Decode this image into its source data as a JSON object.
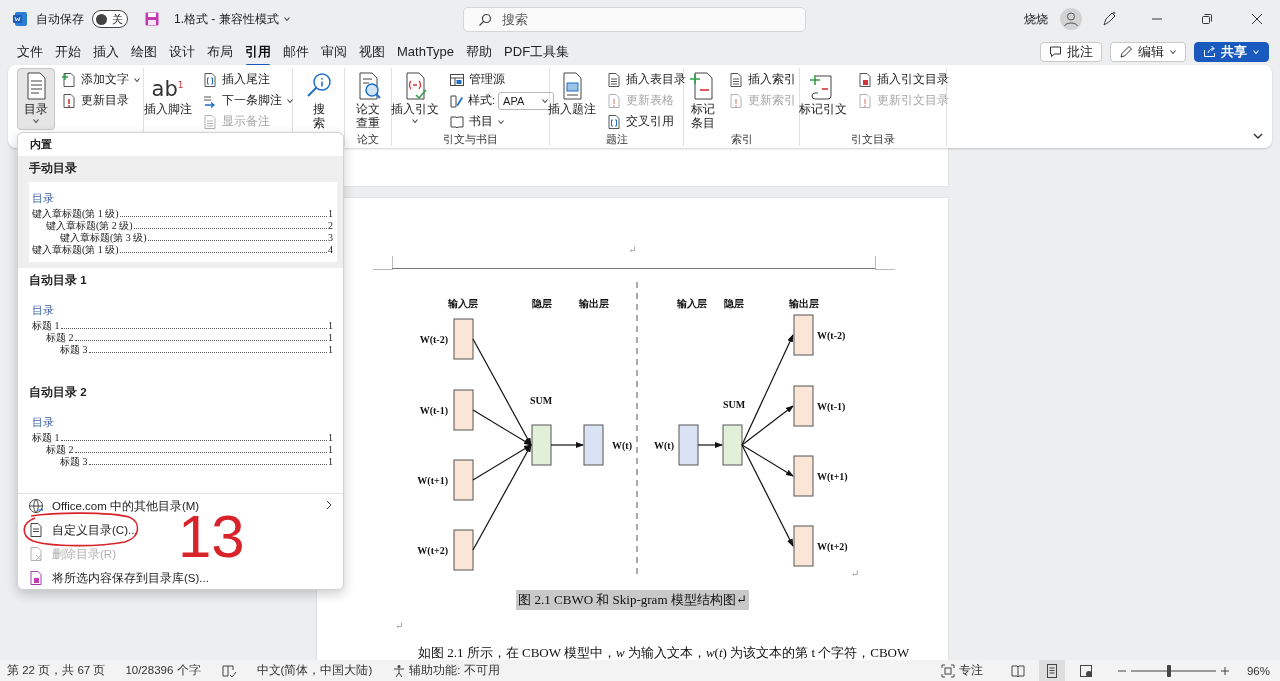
{
  "title_bar": {
    "autosave_label": "自动保存",
    "autosave": {
      "on": false,
      "label": "关"
    },
    "document_title": "1.格式 - 兼容性模式",
    "search": {
      "placeholder": "搜索"
    },
    "user_name": "烧烧"
  },
  "ribbon_tabs": [
    {
      "label": "文件",
      "selected": false
    },
    {
      "label": "开始",
      "selected": false
    },
    {
      "label": "插入",
      "selected": false
    },
    {
      "label": "绘图",
      "selected": false
    },
    {
      "label": "设计",
      "selected": false
    },
    {
      "label": "布局",
      "selected": false
    },
    {
      "label": "引用",
      "selected": true
    },
    {
      "label": "邮件",
      "selected": false
    },
    {
      "label": "审阅",
      "selected": false
    },
    {
      "label": "视图",
      "selected": false
    },
    {
      "label": "MathType",
      "selected": false
    },
    {
      "label": "帮助",
      "selected": false
    },
    {
      "label": "PDF工具集",
      "selected": false
    }
  ],
  "header_buttons": [
    {
      "kind": "comments",
      "label": "批注",
      "dropdown": false
    },
    {
      "kind": "editing",
      "label": "编辑",
      "dropdown": true
    },
    {
      "kind": "share",
      "label": "共享",
      "dropdown": true
    }
  ],
  "ribbon": {
    "groups": [
      {
        "items": [
          {
            "kind": "large",
            "lines": [
              "目录"
            ],
            "dropdown": true,
            "expanded": true
          },
          {
            "kind": "stack",
            "items": [
              {
                "kind": "command",
                "label": "添加文字",
                "dropdown": true,
                "disabled": false
              },
              {
                "kind": "command",
                "label": "更新目录",
                "dropdown": false,
                "disabled": false
              }
            ]
          }
        ]
      },
      {
        "items": [
          {
            "kind": "large",
            "glyph": "ab",
            "glyph_mark": "1",
            "lines": [
              "插入脚注"
            ],
            "dropdown": false,
            "expanded": false
          },
          {
            "kind": "stack",
            "items": [
              {
                "kind": "command",
                "label": "插入尾注",
                "dropdown": false,
                "disabled": false
              },
              {
                "kind": "command",
                "label": "下一条脚注",
                "dropdown": true,
                "disabled": false
              },
              {
                "kind": "command",
                "label": "显示备注",
                "dropdown": false,
                "disabled": true
              }
            ]
          }
        ]
      },
      {
        "items": [
          {
            "kind": "large",
            "lines": [
              "搜",
              "索"
            ],
            "dropdown": false,
            "expanded": false
          }
        ]
      },
      {
        "label": "论文",
        "items": [
          {
            "kind": "large",
            "lines": [
              "论文",
              "查重"
            ],
            "dropdown": false,
            "expanded": false
          }
        ]
      },
      {
        "label": "引文与书目",
        "items": [
          {
            "kind": "large",
            "lines": [
              "插入引文"
            ],
            "dropdown": true,
            "expanded": false
          },
          {
            "kind": "stack",
            "items": [
              {
                "kind": "command",
                "label": "管理源",
                "dropdown": false,
                "disabled": false
              },
              {
                "kind": "select",
                "label": "样式:",
                "value": "APA"
              },
              {
                "kind": "command",
                "label": "书目",
                "dropdown": true,
                "disabled": false
              }
            ]
          }
        ]
      },
      {
        "label": "题注",
        "items": [
          {
            "kind": "large",
            "lines": [
              "插入题注"
            ],
            "dropdown": false,
            "expanded": false
          },
          {
            "kind": "stack",
            "items": [
              {
                "kind": "command",
                "label": "插入表目录",
                "dropdown": false,
                "disabled": false
              },
              {
                "kind": "command",
                "label": "更新表格",
                "dropdown": false,
                "disabled": true
              },
              {
                "kind": "command",
                "label": "交叉引用",
                "dropdown": false,
                "disabled": false
              }
            ]
          }
        ]
      },
      {
        "label": "索引",
        "items": [
          {
            "kind": "large",
            "lines": [
              "标记",
              "条目"
            ],
            "dropdown": false,
            "expanded": false
          },
          {
            "kind": "stack",
            "items": [
              {
                "kind": "command",
                "label": "插入索引",
                "dropdown": false,
                "disabled": false
              },
              {
                "kind": "command",
                "label": "更新索引",
                "dropdown": false,
                "disabled": true
              }
            ]
          }
        ]
      },
      {
        "label": "引文目录",
        "items": [
          {
            "kind": "large",
            "lines": [
              "标记引文"
            ],
            "dropdown": false,
            "expanded": false
          },
          {
            "kind": "stack",
            "items": [
              {
                "kind": "command",
                "label": "插入引文目录",
                "dropdown": false,
                "disabled": false
              },
              {
                "kind": "command",
                "label": "更新引文目录",
                "dropdown": false,
                "disabled": true
              }
            ]
          }
        ]
      }
    ]
  },
  "toc_menu": {
    "section": "内置",
    "galleries": [
      {
        "title": "手动目录",
        "selected": true,
        "heading": "目录",
        "entries": [
          {
            "text": "键入章标题(第 1 级)",
            "page": "1",
            "children": [
              {
                "text": "键入章标题(第 2 级)",
                "page": "2",
                "children": [
                  {
                    "text": "键入章标题(第 3 级)",
                    "page": "3"
                  }
                ]
              }
            ]
          },
          {
            "text": "键入章标题(第 1 级)",
            "page": "4"
          }
        ]
      },
      {
        "title": "自动目录 1",
        "selected": false,
        "heading": "目录",
        "entries": [
          {
            "text": "标题 1",
            "page": "1",
            "children": [
              {
                "text": "标题 2",
                "page": "1",
                "children": [
                  {
                    "text": "标题 3",
                    "page": "1"
                  }
                ]
              }
            ]
          }
        ]
      },
      {
        "title": "自动目录 2",
        "selected": false,
        "heading": "目录",
        "entries": [
          {
            "text": "标题 1",
            "page": "1",
            "children": [
              {
                "text": "标题 2",
                "page": "1",
                "children": [
                  {
                    "text": "标题 3",
                    "page": "1"
                  }
                ]
              }
            ]
          }
        ]
      }
    ],
    "commands": [
      {
        "kind": "web",
        "label": "Office.com 中的其他目录(M)",
        "disabled": false,
        "submenu": true
      },
      {
        "kind": "custom",
        "label": "自定义目录(C)...",
        "disabled": false,
        "submenu": false
      },
      {
        "kind": "remove",
        "label": "删除目录(R)",
        "disabled": true,
        "submenu": false
      },
      {
        "kind": "save",
        "label": "将所选内容保存到目录库(S)...",
        "disabled": false,
        "submenu": false
      }
    ],
    "annotation": {
      "number": "13"
    }
  },
  "document": {
    "header_mark": "↵",
    "figure": {
      "left": {
        "headers": [
          "输入层",
          "隐层",
          "输出层"
        ],
        "inputs": [
          "W(t-2)",
          "W(t-1)",
          "W(t+1)",
          "W(t+2)"
        ],
        "hidden": "SUM",
        "output": "W(t)"
      },
      "right": {
        "headers": [
          "输入层",
          "隐层",
          "输出层"
        ],
        "input": "W(t)",
        "hidden": "SUM",
        "outputs": [
          "W(t-2)",
          "W(t-1)",
          "W(t+1)",
          "W(t+2)"
        ]
      },
      "end_mark": "↵"
    },
    "caption": "图 2.1 CBWO 和 Skip-gram 模型结构图↵",
    "caption_highlighted": true,
    "blank_mark": "↵",
    "paragraph": "如图 2.1 所示，在 CBOW 模型中，*w* 为输入文本，*w*(*t*) 为该文本的第 t 个字符，CBOW"
  },
  "status_bar": {
    "page": "第 22 页，共 67 页",
    "words": "10/28396 个字",
    "language": "中文(简体，中国大陆)",
    "accessibility": "辅助功能: 不可用",
    "focus": "专注",
    "views": [
      {
        "kind": "read",
        "selected": false
      },
      {
        "kind": "print",
        "selected": true
      },
      {
        "kind": "web",
        "selected": false
      }
    ],
    "zoom": {
      "level": 0.45,
      "reading": "96%"
    }
  }
}
